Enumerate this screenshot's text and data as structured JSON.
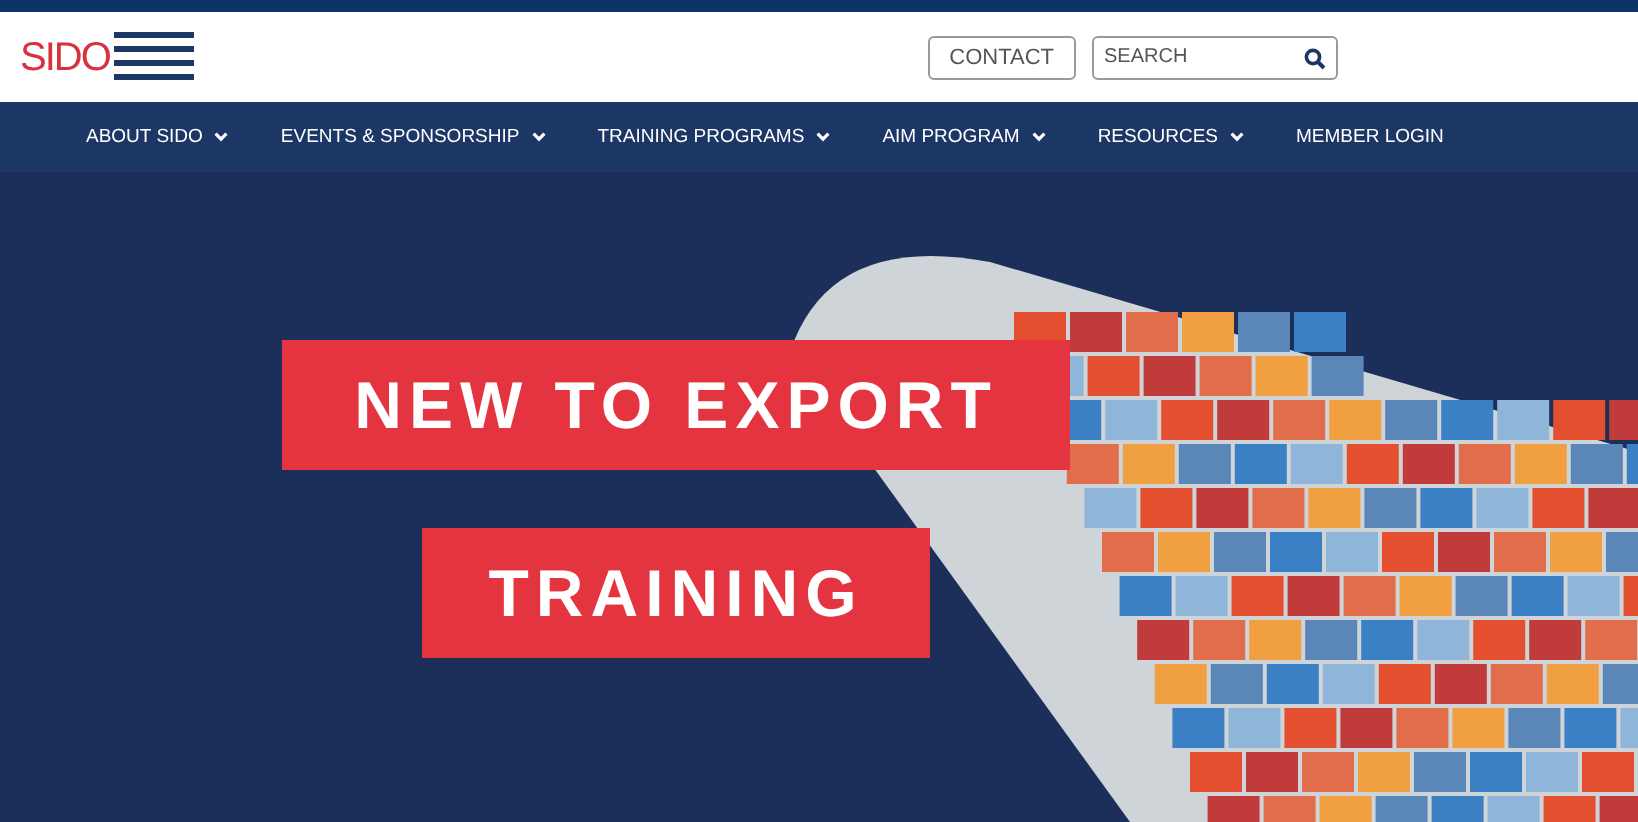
{
  "logo": {
    "text": "SIDO"
  },
  "header": {
    "contact_button": "CONTACT",
    "search": {
      "placeholder": "SEARCH"
    }
  },
  "nav": [
    {
      "label": "ABOUT SIDO",
      "dropdown": true
    },
    {
      "label": "EVENTS & SPONSORSHIP",
      "dropdown": true
    },
    {
      "label": "TRAINING PROGRAMS",
      "dropdown": true
    },
    {
      "label": "AIM PROGRAM",
      "dropdown": true
    },
    {
      "label": "RESOURCES",
      "dropdown": true
    },
    {
      "label": "MEMBER LOGIN",
      "dropdown": false
    }
  ],
  "hero": {
    "headlines": [
      "NEW TO EXPORT",
      "TRAINING"
    ]
  }
}
